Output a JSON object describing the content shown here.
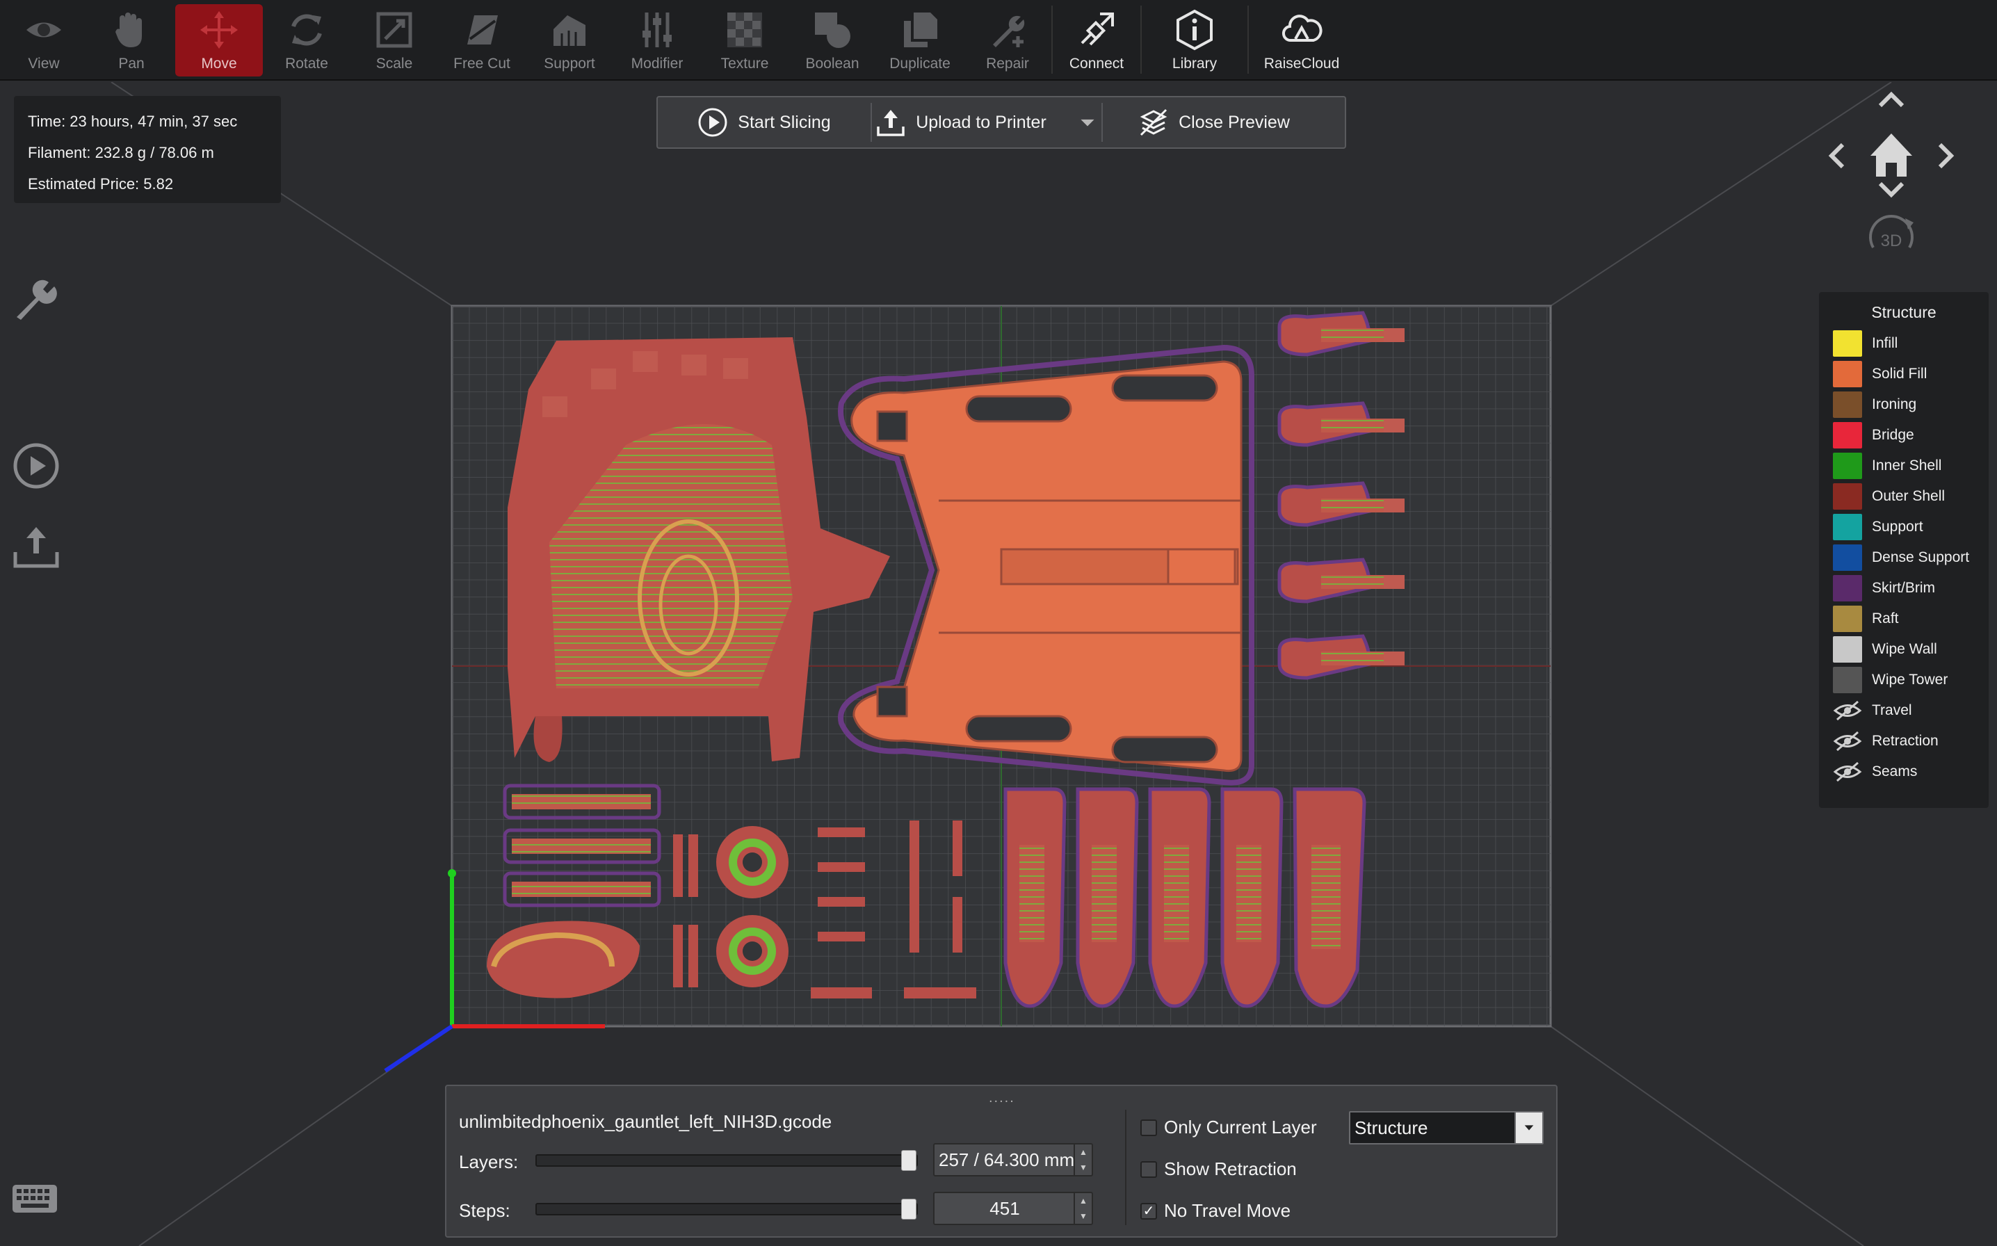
{
  "toolbar": {
    "items": [
      {
        "label": "View",
        "icon": "eye-icon"
      },
      {
        "label": "Pan",
        "icon": "hand-icon"
      },
      {
        "label": "Move",
        "icon": "move-icon"
      },
      {
        "label": "Rotate",
        "icon": "rotate-icon"
      },
      {
        "label": "Scale",
        "icon": "scale-icon"
      },
      {
        "label": "Free Cut",
        "icon": "free-cut-icon"
      },
      {
        "label": "Support",
        "icon": "support-icon"
      },
      {
        "label": "Modifier",
        "icon": "modifier-icon"
      },
      {
        "label": "Texture",
        "icon": "texture-icon"
      },
      {
        "label": "Boolean",
        "icon": "boolean-icon"
      },
      {
        "label": "Duplicate",
        "icon": "duplicate-icon"
      },
      {
        "label": "Repair",
        "icon": "repair-icon"
      },
      {
        "label": "Connect",
        "icon": "connect-icon"
      },
      {
        "label": "Library",
        "icon": "library-icon"
      },
      {
        "label": "RaiseCloud",
        "icon": "cloud-icon"
      }
    ],
    "active": "Move"
  },
  "info": {
    "time": "Time: 23 hours, 47 min, 37 sec",
    "filament": "Filament: 232.8 g / 78.06 m",
    "price": "Estimated Price: 5.82"
  },
  "actions": {
    "start_slicing": "Start Slicing",
    "upload": "Upload to Printer",
    "close_preview": "Close Preview"
  },
  "nav": {
    "label_3d": "3D"
  },
  "legend": {
    "title": "Structure",
    "items": [
      {
        "label": "Infill",
        "color": "#f2e230"
      },
      {
        "label": "Solid Fill",
        "color": "#e36a3a"
      },
      {
        "label": "Ironing",
        "color": "#7a4f2a"
      },
      {
        "label": "Bridge",
        "color": "#e8263a"
      },
      {
        "label": "Inner Shell",
        "color": "#1f9a1a"
      },
      {
        "label": "Outer Shell",
        "color": "#8a2a22"
      },
      {
        "label": "Support",
        "color": "#14a3a0"
      },
      {
        "label": "Dense Support",
        "color": "#124ea0"
      },
      {
        "label": "Skirt/Brim",
        "color": "#5a2a6a"
      },
      {
        "label": "Raft",
        "color": "#a88a40"
      },
      {
        "label": "Wipe Wall",
        "color": "#c8c8c8"
      },
      {
        "label": "Wipe Tower",
        "color": "#555555"
      }
    ],
    "hidden": [
      {
        "label": "Travel"
      },
      {
        "label": "Retraction"
      },
      {
        "label": "Seams"
      }
    ]
  },
  "panel": {
    "grip": ".....",
    "filename": "unlimbitedphoenix_gauntlet_left_NIH3D.gcode",
    "layers_label": "Layers:",
    "layers_value": "257 / 64.300 mm",
    "layers_fraction": 1.0,
    "steps_label": "Steps:",
    "steps_value": "451",
    "steps_fraction": 1.0,
    "only_current_layer": {
      "label": "Only Current Layer",
      "checked": false
    },
    "show_retraction": {
      "label": "Show Retraction",
      "checked": false
    },
    "no_travel_move": {
      "label": "No Travel Move",
      "checked": true
    },
    "view_select": "Structure"
  }
}
